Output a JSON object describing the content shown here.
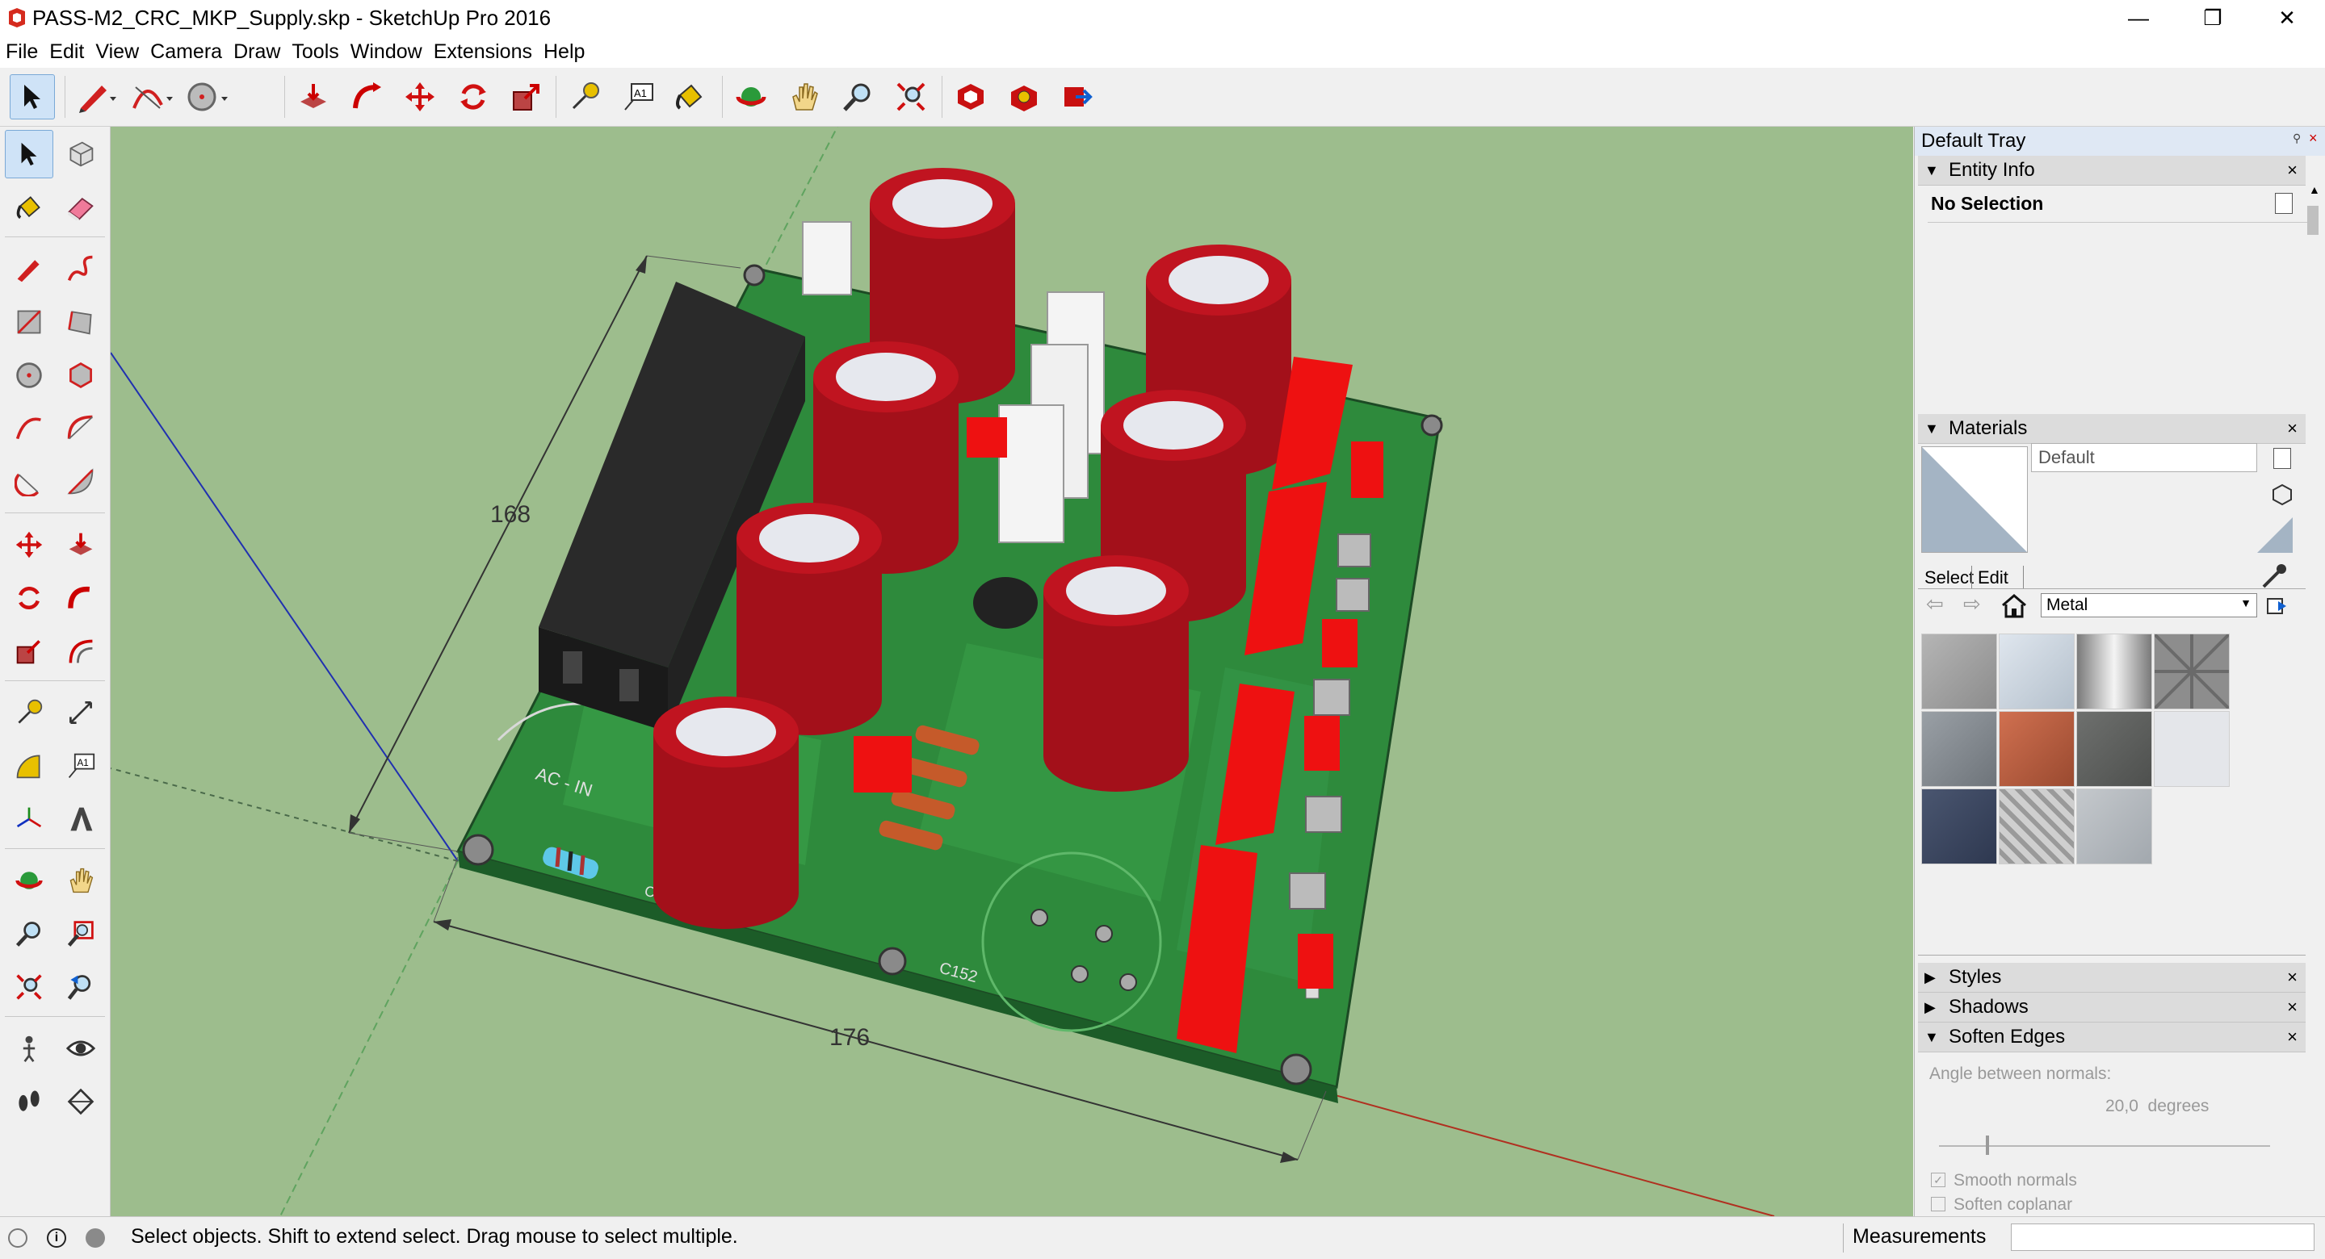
{
  "window": {
    "title": "PASS-M2_CRC_MKP_Supply.skp - SketchUp Pro 2016",
    "minimize": "—",
    "maximize": "❐",
    "close": "✕"
  },
  "menu": [
    "File",
    "Edit",
    "View",
    "Camera",
    "Draw",
    "Tools",
    "Window",
    "Extensions",
    "Help"
  ],
  "viewport": {
    "dim_vertical": "168",
    "dim_horizontal": "176"
  },
  "tray": {
    "title": "Default Tray",
    "entity_info": {
      "header": "Entity Info",
      "selection": "No Selection"
    },
    "materials": {
      "header": "Materials",
      "current_material": "Default",
      "tab_select": "Select",
      "tab_edit": "Edit",
      "library": "Metal"
    },
    "styles": {
      "header": "Styles"
    },
    "shadows": {
      "header": "Shadows"
    },
    "soften_edges": {
      "header": "Soften Edges",
      "angle_label": "Angle between normals:",
      "angle_value": "20,0  degrees",
      "smooth_normals": "Smooth normals",
      "soften_coplanar": "Soften coplanar"
    }
  },
  "status": {
    "hint": "Select objects. Shift to extend select. Drag mouse to select multiple.",
    "measurements_label": "Measurements"
  },
  "colors": {
    "viewport_bg": "#9dbd8d",
    "pcb": "#2e8a3c",
    "capacitor": "#a3101a",
    "red_part": "#ee1111"
  }
}
